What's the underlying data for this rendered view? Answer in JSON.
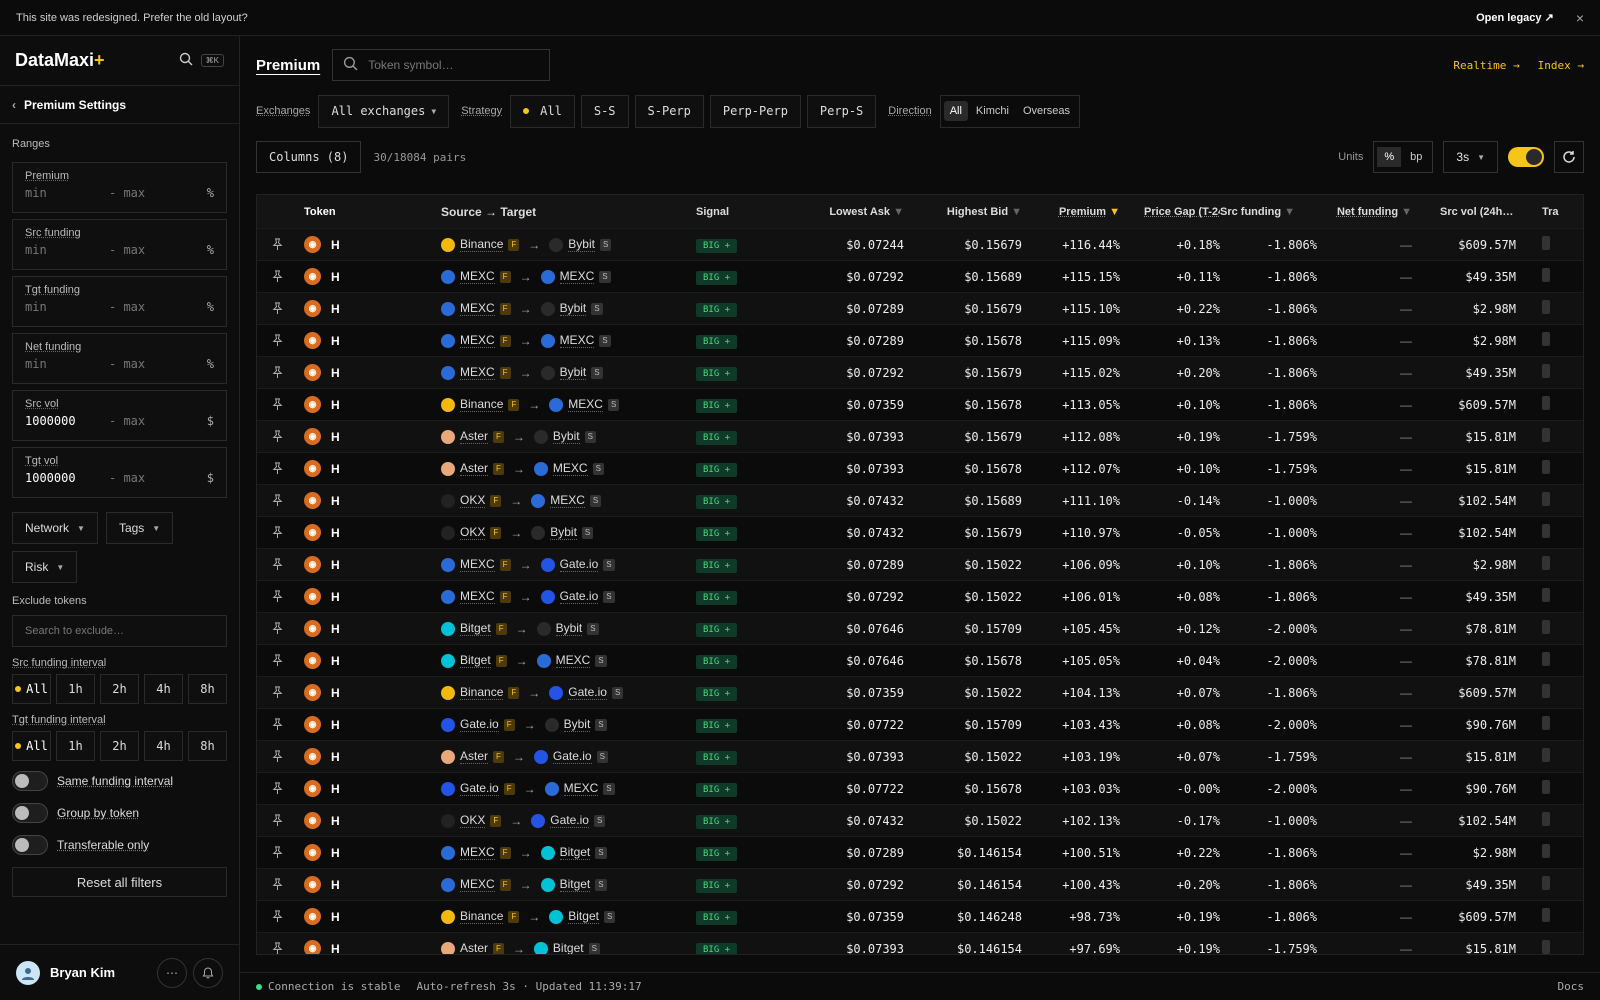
{
  "banner": {
    "text": "This site was redesigned. Prefer the old layout?",
    "legacy_label": "Open legacy ↗",
    "close": "×"
  },
  "brand": {
    "name": "DataMaxi",
    "plus": "+",
    "shortcut": "⌘K"
  },
  "sidebar": {
    "back_label": "Premium Settings",
    "ranges_label": "Ranges",
    "ranges": [
      {
        "label": "Premium",
        "min": "min",
        "max": "- max",
        "unit": "%"
      },
      {
        "label": "Src funding",
        "min": "min",
        "max": "- max",
        "unit": "%"
      },
      {
        "label": "Tgt funding",
        "min": "min",
        "max": "- max",
        "unit": "%"
      },
      {
        "label": "Net funding",
        "min": "min",
        "max": "- max",
        "unit": "%"
      },
      {
        "label": "Src vol",
        "min": "1000000",
        "max": "- max",
        "unit": "$"
      },
      {
        "label": "Tgt vol",
        "min": "1000000",
        "max": "- max",
        "unit": "$"
      }
    ],
    "network_label": "Network",
    "tags_label": "Tags",
    "risk_label": "Risk",
    "exclude_label": "Exclude tokens",
    "exclude_placeholder": "Search to exclude…",
    "src_interval_label": "Src funding interval",
    "tgt_interval_label": "Tgt funding interval",
    "intervals": [
      "All",
      "1h",
      "2h",
      "4h",
      "8h"
    ],
    "toggles": [
      "Same funding interval",
      "Group by token",
      "Transferable only"
    ],
    "reset_label": "Reset all filters",
    "user_name": "Bryan Kim"
  },
  "main": {
    "title": "Premium",
    "search_placeholder": "Token symbol…",
    "links": [
      "Realtime →",
      "Index →"
    ],
    "exchanges_label": "Exchanges",
    "exchanges_value": "All exchanges",
    "strategy_label": "Strategy",
    "strategies": [
      "All",
      "S-S",
      "S-Perp",
      "Perp-Perp",
      "Perp-S"
    ],
    "direction_label": "Direction",
    "directions": [
      "All",
      "Kimchi",
      "Overseas"
    ],
    "columns_label": "Columns (8)",
    "pairs": "30/18084 pairs",
    "units_label": "Units",
    "units": [
      "%",
      "bp"
    ],
    "interval": "3s"
  },
  "table": {
    "headers": {
      "token": "Token",
      "route": "Source → Target",
      "signal": "Signal",
      "ask": "Lowest Ask",
      "bid": "Highest Bid",
      "premium": "Premium",
      "gap": "Price Gap (T-24h",
      "sfund": "Src funding",
      "nfund": "Net funding",
      "svol": "Src vol (24h…",
      "tr": "Tra"
    },
    "rows": [
      {
        "token": "H",
        "src": "Binance",
        "stag": "F",
        "tgt": "Bybit",
        "ttag": "S",
        "signal": "BIG +",
        "ask": "$0.07244",
        "bid": "$0.15679",
        "premium": "+116.44%",
        "gap": "+0.18%",
        "sfund": "-1.806%",
        "nfund": "—",
        "svol": "$609.57M"
      },
      {
        "token": "H",
        "src": "MEXC",
        "stag": "F",
        "tgt": "MEXC",
        "ttag": "S",
        "signal": "BIG +",
        "ask": "$0.07292",
        "bid": "$0.15689",
        "premium": "+115.15%",
        "gap": "+0.11%",
        "sfund": "-1.806%",
        "nfund": "—",
        "svol": "$49.35M"
      },
      {
        "token": "H",
        "src": "MEXC",
        "stag": "F",
        "tgt": "Bybit",
        "ttag": "S",
        "signal": "BIG +",
        "ask": "$0.07289",
        "bid": "$0.15679",
        "premium": "+115.10%",
        "gap": "+0.22%",
        "sfund": "-1.806%",
        "nfund": "—",
        "svol": "$2.98M"
      },
      {
        "token": "H",
        "src": "MEXC",
        "stag": "F",
        "tgt": "MEXC",
        "ttag": "S",
        "signal": "BIG +",
        "ask": "$0.07289",
        "bid": "$0.15678",
        "premium": "+115.09%",
        "gap": "+0.13%",
        "sfund": "-1.806%",
        "nfund": "—",
        "svol": "$2.98M"
      },
      {
        "token": "H",
        "src": "MEXC",
        "stag": "F",
        "tgt": "Bybit",
        "ttag": "S",
        "signal": "BIG +",
        "ask": "$0.07292",
        "bid": "$0.15679",
        "premium": "+115.02%",
        "gap": "+0.20%",
        "sfund": "-1.806%",
        "nfund": "—",
        "svol": "$49.35M"
      },
      {
        "token": "H",
        "src": "Binance",
        "stag": "F",
        "tgt": "MEXC",
        "ttag": "S",
        "signal": "BIG +",
        "ask": "$0.07359",
        "bid": "$0.15678",
        "premium": "+113.05%",
        "gap": "+0.10%",
        "sfund": "-1.806%",
        "nfund": "—",
        "svol": "$609.57M"
      },
      {
        "token": "H",
        "src": "Aster",
        "stag": "F",
        "tgt": "Bybit",
        "ttag": "S",
        "signal": "BIG +",
        "ask": "$0.07393",
        "bid": "$0.15679",
        "premium": "+112.08%",
        "gap": "+0.19%",
        "sfund": "-1.759%",
        "nfund": "—",
        "svol": "$15.81M"
      },
      {
        "token": "H",
        "src": "Aster",
        "stag": "F",
        "tgt": "MEXC",
        "ttag": "S",
        "signal": "BIG +",
        "ask": "$0.07393",
        "bid": "$0.15678",
        "premium": "+112.07%",
        "gap": "+0.10%",
        "sfund": "-1.759%",
        "nfund": "—",
        "svol": "$15.81M"
      },
      {
        "token": "H",
        "src": "OKX",
        "stag": "F",
        "tgt": "MEXC",
        "ttag": "S",
        "signal": "BIG +",
        "ask": "$0.07432",
        "bid": "$0.15689",
        "premium": "+111.10%",
        "gap": "-0.14%",
        "sfund": "-1.000%",
        "nfund": "—",
        "svol": "$102.54M"
      },
      {
        "token": "H",
        "src": "OKX",
        "stag": "F",
        "tgt": "Bybit",
        "ttag": "S",
        "signal": "BIG +",
        "ask": "$0.07432",
        "bid": "$0.15679",
        "premium": "+110.97%",
        "gap": "-0.05%",
        "sfund": "-1.000%",
        "nfund": "—",
        "svol": "$102.54M"
      },
      {
        "token": "H",
        "src": "MEXC",
        "stag": "F",
        "tgt": "Gate.io",
        "ttag": "S",
        "signal": "BIG +",
        "ask": "$0.07289",
        "bid": "$0.15022",
        "premium": "+106.09%",
        "gap": "+0.10%",
        "sfund": "-1.806%",
        "nfund": "—",
        "svol": "$2.98M"
      },
      {
        "token": "H",
        "src": "MEXC",
        "stag": "F",
        "tgt": "Gate.io",
        "ttag": "S",
        "signal": "BIG +",
        "ask": "$0.07292",
        "bid": "$0.15022",
        "premium": "+106.01%",
        "gap": "+0.08%",
        "sfund": "-1.806%",
        "nfund": "—",
        "svol": "$49.35M"
      },
      {
        "token": "H",
        "src": "Bitget",
        "stag": "F",
        "tgt": "Bybit",
        "ttag": "S",
        "signal": "BIG +",
        "ask": "$0.07646",
        "bid": "$0.15709",
        "premium": "+105.45%",
        "gap": "+0.12%",
        "sfund": "-2.000%",
        "nfund": "—",
        "svol": "$78.81M"
      },
      {
        "token": "H",
        "src": "Bitget",
        "stag": "F",
        "tgt": "MEXC",
        "ttag": "S",
        "signal": "BIG +",
        "ask": "$0.07646",
        "bid": "$0.15678",
        "premium": "+105.05%",
        "gap": "+0.04%",
        "sfund": "-2.000%",
        "nfund": "—",
        "svol": "$78.81M"
      },
      {
        "token": "H",
        "src": "Binance",
        "stag": "F",
        "tgt": "Gate.io",
        "ttag": "S",
        "signal": "BIG +",
        "ask": "$0.07359",
        "bid": "$0.15022",
        "premium": "+104.13%",
        "gap": "+0.07%",
        "sfund": "-1.806%",
        "nfund": "—",
        "svol": "$609.57M"
      },
      {
        "token": "H",
        "src": "Gate.io",
        "stag": "F",
        "tgt": "Bybit",
        "ttag": "S",
        "signal": "BIG +",
        "ask": "$0.07722",
        "bid": "$0.15709",
        "premium": "+103.43%",
        "gap": "+0.08%",
        "sfund": "-2.000%",
        "nfund": "—",
        "svol": "$90.76M"
      },
      {
        "token": "H",
        "src": "Aster",
        "stag": "F",
        "tgt": "Gate.io",
        "ttag": "S",
        "signal": "BIG +",
        "ask": "$0.07393",
        "bid": "$0.15022",
        "premium": "+103.19%",
        "gap": "+0.07%",
        "sfund": "-1.759%",
        "nfund": "—",
        "svol": "$15.81M"
      },
      {
        "token": "H",
        "src": "Gate.io",
        "stag": "F",
        "tgt": "MEXC",
        "ttag": "S",
        "signal": "BIG +",
        "ask": "$0.07722",
        "bid": "$0.15678",
        "premium": "+103.03%",
        "gap": "-0.00%",
        "sfund": "-2.000%",
        "nfund": "—",
        "svol": "$90.76M"
      },
      {
        "token": "H",
        "src": "OKX",
        "stag": "F",
        "tgt": "Gate.io",
        "ttag": "S",
        "signal": "BIG +",
        "ask": "$0.07432",
        "bid": "$0.15022",
        "premium": "+102.13%",
        "gap": "-0.17%",
        "sfund": "-1.000%",
        "nfund": "—",
        "svol": "$102.54M"
      },
      {
        "token": "H",
        "src": "MEXC",
        "stag": "F",
        "tgt": "Bitget",
        "ttag": "S",
        "signal": "BIG +",
        "ask": "$0.07289",
        "bid": "$0.146154",
        "premium": "+100.51%",
        "gap": "+0.22%",
        "sfund": "-1.806%",
        "nfund": "—",
        "svol": "$2.98M"
      },
      {
        "token": "H",
        "src": "MEXC",
        "stag": "F",
        "tgt": "Bitget",
        "ttag": "S",
        "signal": "BIG +",
        "ask": "$0.07292",
        "bid": "$0.146154",
        "premium": "+100.43%",
        "gap": "+0.20%",
        "sfund": "-1.806%",
        "nfund": "—",
        "svol": "$49.35M"
      },
      {
        "token": "H",
        "src": "Binance",
        "stag": "F",
        "tgt": "Bitget",
        "ttag": "S",
        "signal": "BIG +",
        "ask": "$0.07359",
        "bid": "$0.146248",
        "premium": "+98.73%",
        "gap": "+0.19%",
        "sfund": "-1.806%",
        "nfund": "—",
        "svol": "$609.57M"
      },
      {
        "token": "H",
        "src": "Aster",
        "stag": "F",
        "tgt": "Bitget",
        "ttag": "S",
        "signal": "BIG +",
        "ask": "$0.07393",
        "bid": "$0.146154",
        "premium": "+97.69%",
        "gap": "+0.19%",
        "sfund": "-1.759%",
        "nfund": "—",
        "svol": "$15.81M"
      }
    ]
  },
  "status": {
    "connection": "Connection is stable",
    "refresh": "Auto-refresh 3s · Updated 11:39:17",
    "docs": "Docs"
  },
  "colors": {
    "accent": "#f5c518",
    "positive": "#3ddc84",
    "negative": "#ff4d4d",
    "token": "#d96c1e"
  },
  "exchange_colors": {
    "Binance": "#f0b90b",
    "MEXC": "#2a6bd8",
    "Bybit": "#2a2a2a",
    "Aster": "#e8a87c",
    "OKX": "#222222",
    "Gate.io": "#2354e6",
    "Bitget": "#00c2d6"
  },
  "exchange_icons": {
    "Binance": "binance-icon",
    "MEXC": "mexc-icon",
    "Bybit": "bybit-icon",
    "Aster": "aster-icon",
    "OKX": "okx-icon",
    "Gate.io": "gateio-icon",
    "Bitget": "bitget-icon"
  }
}
